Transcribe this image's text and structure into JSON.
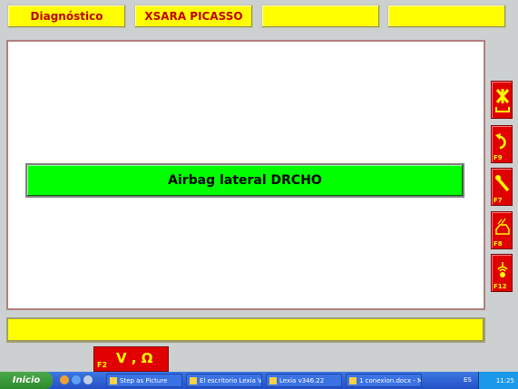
{
  "header": {
    "tabs": [
      {
        "label": "Diagnóstico"
      },
      {
        "label": "XSARA PICASSO"
      },
      {
        "label": ""
      },
      {
        "label": ""
      }
    ]
  },
  "main": {
    "banner_text": "Airbag lateral DRCHO"
  },
  "side_buttons": [
    {
      "icon": "exit-icon",
      "key": ""
    },
    {
      "icon": "undo-arrow-icon",
      "key": "F9"
    },
    {
      "icon": "wrench-icon",
      "key": "F7"
    },
    {
      "icon": "car-icon",
      "key": "F8"
    },
    {
      "icon": "antenna-icon",
      "key": "F12"
    }
  ],
  "measure_button": {
    "key": "F2",
    "label": "V , Ω"
  },
  "taskbar": {
    "start_label": "Inicio",
    "tasks": [
      {
        "label": "Step as Picture"
      },
      {
        "label": "El escritorio Lexia V1...."
      },
      {
        "label": "Lexia v346.22"
      },
      {
        "label": "1 conexion.docx - Mic..."
      }
    ],
    "language": "ES",
    "clock": "11:25"
  },
  "colors": {
    "accent_yellow": "#ffff00",
    "accent_red": "#e00000",
    "banner_green": "#00ff00"
  }
}
